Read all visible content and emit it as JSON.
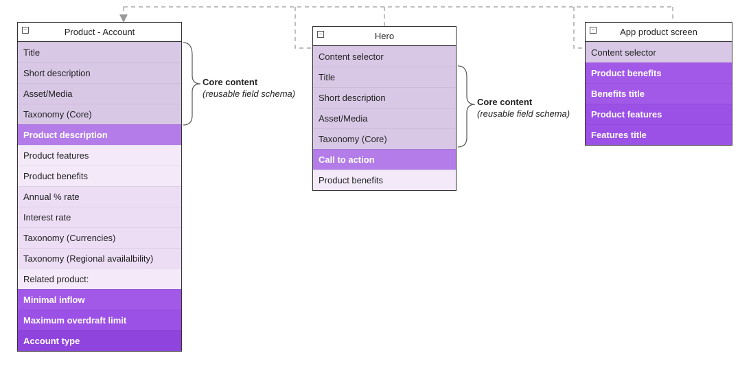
{
  "tables": {
    "product_account": {
      "title": "Product - Account",
      "rows": [
        {
          "label": "Title",
          "tier": "tier-core"
        },
        {
          "label": "Short description",
          "tier": "tier-core"
        },
        {
          "label": "Asset/Media",
          "tier": "tier-core"
        },
        {
          "label": "Taxonomy (Core)",
          "tier": "tier-core"
        },
        {
          "label": "Product description",
          "tier": "tier-med"
        },
        {
          "label": "Product features",
          "tier": "tier-vlight"
        },
        {
          "label": "Product benefits",
          "tier": "tier-vlight"
        },
        {
          "label": "Annual % rate",
          "tier": "tier-light"
        },
        {
          "label": "Interest rate",
          "tier": "tier-light"
        },
        {
          "label": "Taxonomy (Currencies)",
          "tier": "tier-light"
        },
        {
          "label": "Taxonomy (Regional availalbility)",
          "tier": "tier-light"
        },
        {
          "label": "Related product:",
          "tier": "tier-vlight"
        },
        {
          "label": "Minimal inflow",
          "tier": "tier-bright"
        },
        {
          "label": "Maximum overdraft limit",
          "tier": "tier-bright2"
        },
        {
          "label": "Account type",
          "tier": "tier-brighter"
        }
      ]
    },
    "hero": {
      "title": "Hero",
      "rows": [
        {
          "label": "Content selector",
          "tier": "tier-selector"
        },
        {
          "label": "Title",
          "tier": "tier-core"
        },
        {
          "label": "Short description",
          "tier": "tier-core"
        },
        {
          "label": "Asset/Media",
          "tier": "tier-core"
        },
        {
          "label": "Taxonomy (Core)",
          "tier": "tier-core"
        },
        {
          "label": "Call to action",
          "tier": "tier-med"
        },
        {
          "label": "Product benefits",
          "tier": "tier-vlight"
        }
      ]
    },
    "app_product": {
      "title": "App product screen",
      "rows": [
        {
          "label": "Content selector",
          "tier": "tier-selector"
        },
        {
          "label": "Product benefits",
          "tier": "tier-bright"
        },
        {
          "label": "Benefits title",
          "tier": "tier-bright"
        },
        {
          "label": "Product features",
          "tier": "tier-bright2"
        },
        {
          "label": "Features title",
          "tier": "tier-bright2"
        }
      ]
    }
  },
  "annotations": {
    "a1": {
      "line1": "Core content",
      "line2": "(reusable field schema)"
    },
    "a2": {
      "line1": "Core content",
      "line2": "(reusable field schema)"
    }
  },
  "icon_glyph": "−"
}
